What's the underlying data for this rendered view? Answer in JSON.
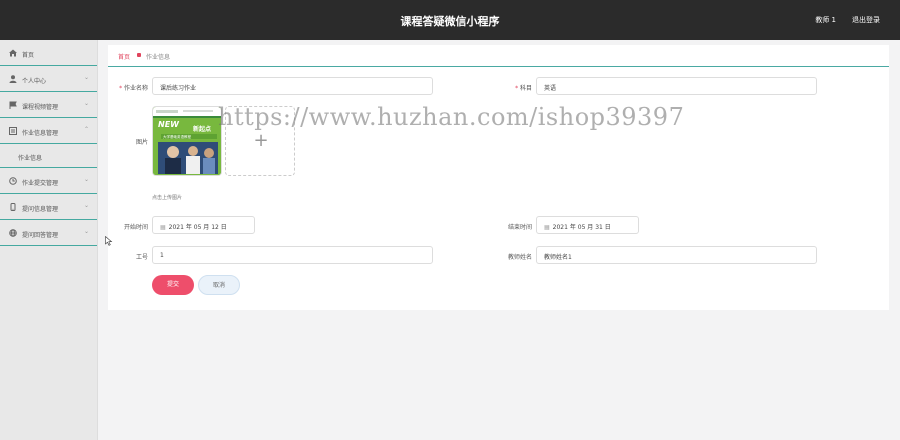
{
  "header": {
    "title": "课程答疑微信小程序",
    "user": "教师 1",
    "logout": "退出登录"
  },
  "sidebar": {
    "items": [
      {
        "label": "首页",
        "icon": "home-icon"
      },
      {
        "label": "个人中心",
        "icon": "person-icon"
      },
      {
        "label": "课程视频管理",
        "icon": "flag-icon"
      },
      {
        "label": "作业信息管理",
        "icon": "document-icon"
      },
      {
        "label": "作业信息",
        "icon": ""
      },
      {
        "label": "作业提交管理",
        "icon": "clock-icon"
      },
      {
        "label": "提问信息管理",
        "icon": "phone-icon"
      },
      {
        "label": "提问回答管理",
        "icon": "globe-icon"
      }
    ]
  },
  "breadcrumb": {
    "home": "首页",
    "current": "作业信息"
  },
  "form": {
    "name_label": "作业名称",
    "name_value": "课后练习作业",
    "subject_label": "科目",
    "subject_value": "英语",
    "image_label": "图片",
    "upload_hint": "点击上传图片",
    "start_label": "开始时间",
    "start_value": "2021 年 05 月 12 日",
    "end_label": "结束时间",
    "end_value": "2021 年 05 月 31 日",
    "worker_label": "工号",
    "worker_value": "1",
    "teacher_label": "教师姓名",
    "teacher_value": "教师姓名1",
    "submit": "提交",
    "cancel": "取消"
  },
  "book": {
    "logo": "NEW",
    "title": "新起点",
    "subtitle": "大学基础英语教程"
  },
  "watermark": "https://www.huzhan.com/ishop39397",
  "colors": {
    "accent": "#45a9a0",
    "danger": "#ee4e6b",
    "topbar": "#2b2b2b"
  }
}
